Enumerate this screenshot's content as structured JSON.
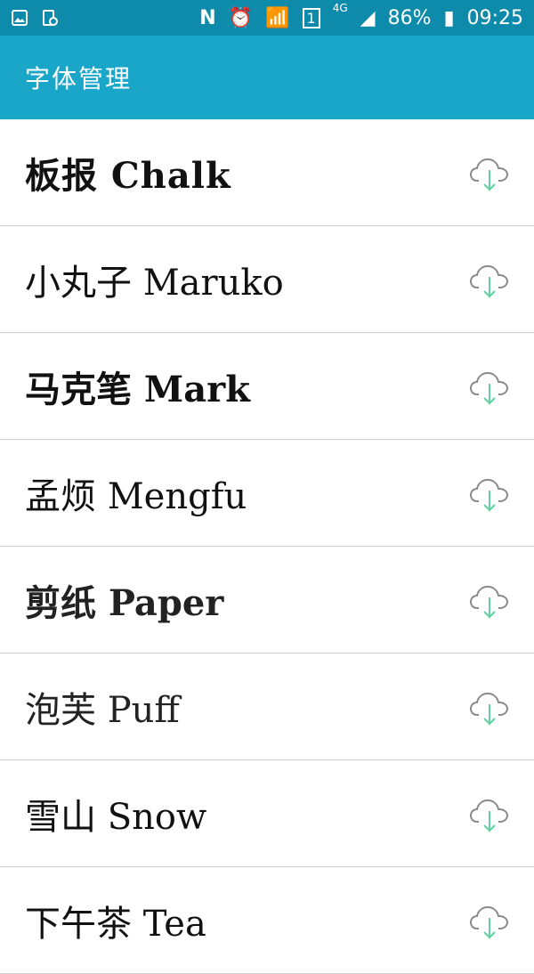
{
  "status_bar": {
    "icons_left": [
      "gallery-icon",
      "screenshot-icon"
    ],
    "icons_right": [
      "nfc-icon",
      "alarm-icon",
      "wifi-icon",
      "sim-icon",
      "signal-icon",
      "battery-icon"
    ],
    "network": "4G",
    "sim_slot": "1",
    "battery": "86%",
    "time": "09:25"
  },
  "app_bar": {
    "title": "字体管理"
  },
  "fonts": [
    {
      "label": "板报 Chalk",
      "action_icon": "cloud-download-icon"
    },
    {
      "label": "小丸子 Maruko",
      "action_icon": "cloud-download-icon"
    },
    {
      "label": "马克笔 Mark",
      "action_icon": "cloud-download-icon"
    },
    {
      "label": "孟烦 Mengfu",
      "action_icon": "cloud-download-icon"
    },
    {
      "label": "剪纸 Paper",
      "action_icon": "cloud-download-icon"
    },
    {
      "label": "泡芙 Puff",
      "action_icon": "cloud-download-icon"
    },
    {
      "label": "雪山 Snow",
      "action_icon": "cloud-download-icon"
    },
    {
      "label": "下午茶 Tea",
      "action_icon": "cloud-download-icon"
    }
  ],
  "colors": {
    "status_bar_bg": "#0e8aaa",
    "app_bar_bg": "#1aa6c8",
    "cloud_outline": "#8a8a8a",
    "download_arrow": "#5fd3a0"
  }
}
